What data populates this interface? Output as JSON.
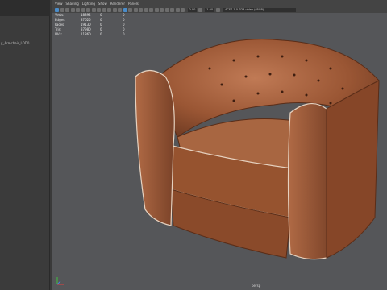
{
  "viewport": {
    "menu": [
      "View",
      "Shading",
      "Lighting",
      "Show",
      "Renderer",
      "Panels"
    ],
    "toolbar": {
      "field_a": "0.00",
      "field_b": "1.00",
      "camera_field": "ACES 1.0 SDR-video (sRGB)"
    },
    "hud": {
      "rows": [
        {
          "label": "Verts:",
          "v1": "18892",
          "v2": "0",
          "v3": "0"
        },
        {
          "label": "Edges:",
          "v1": "37625",
          "v2": "0",
          "v3": "0"
        },
        {
          "label": "Faces:",
          "v1": "19130",
          "v2": "0",
          "v3": "0"
        },
        {
          "label": "Tris:",
          "v1": "37980",
          "v2": "0",
          "v3": "0"
        },
        {
          "label": "UVs:",
          "v1": "11860",
          "v2": "0",
          "v3": "0"
        }
      ]
    },
    "camera_label": "persp"
  },
  "outliner": {
    "item": "y_Armchair_LOD0"
  },
  "colors": {
    "leather": "#a25f3c",
    "leather_dark": "#6e3a22",
    "viewport_bg": "#555659",
    "accent": "#4a8cc9"
  }
}
